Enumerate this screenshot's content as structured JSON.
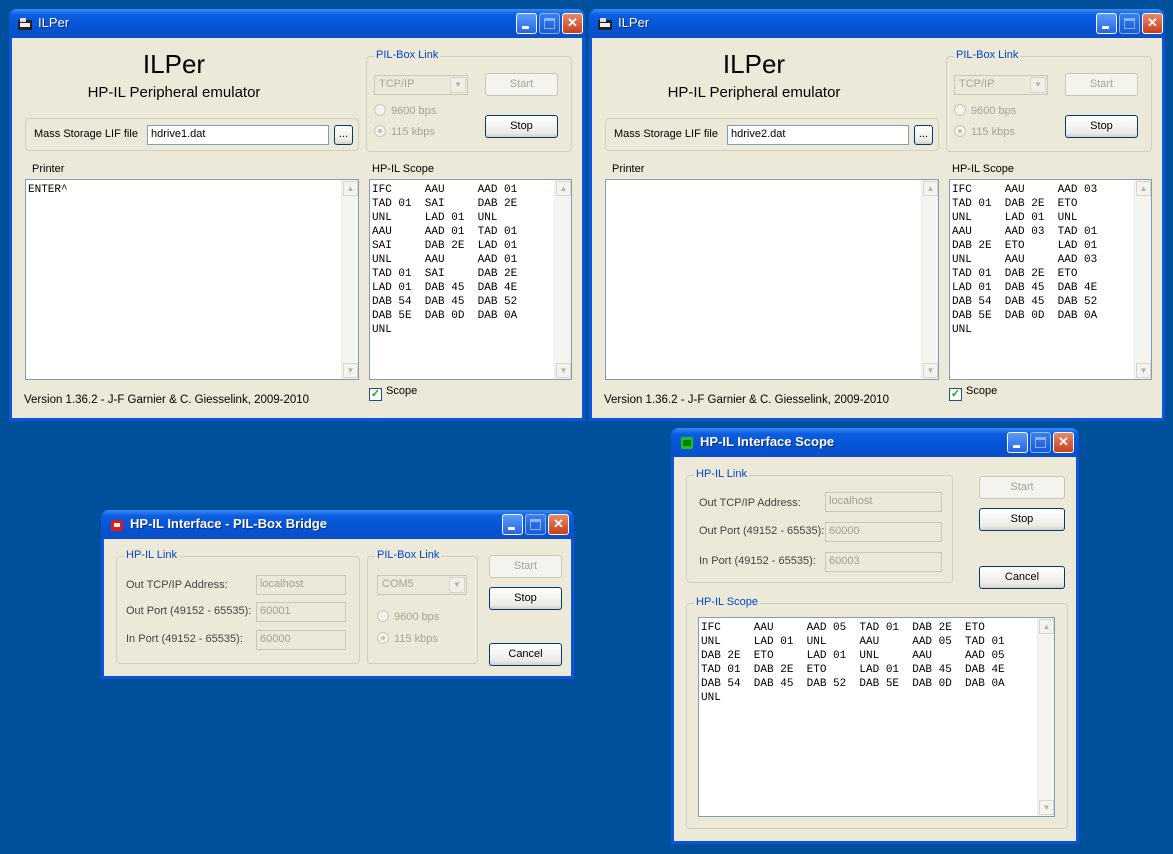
{
  "ilper1": {
    "window_title": "ILPer",
    "app_name": "ILPer",
    "app_subtitle": "HP-IL Peripheral emulator",
    "pilbox_group": "PIL-Box Link",
    "port_value": "TCP/IP",
    "baud_9600": "9600 bps",
    "baud_115": "115 kbps",
    "start_label": "Start",
    "stop_label": "Stop",
    "mass_storage_label": "Mass Storage LIF file",
    "mass_storage_value": "hdrive1.dat",
    "browse_label": "...",
    "printer_label": "Printer",
    "printer_text": "ENTER^",
    "scope_label": "HP-IL Scope",
    "scope_text": "IFC     AAU     AAD 01\nTAD 01  SAI     DAB 2E\nUNL     LAD 01  UNL\nAAU     AAD 01  TAD 01\nSAI     DAB 2E  LAD 01\nUNL     AAU     AAD 01\nTAD 01  SAI     DAB 2E\nLAD 01  DAB 45  DAB 4E\nDAB 54  DAB 45  DAB 52\nDAB 5E  DAB 0D  DAB 0A\nUNL",
    "scope_checkbox": "Scope",
    "version": "Version 1.36.2  -  J-F Garnier & C. Giesselink, 2009-2010"
  },
  "ilper2": {
    "window_title": "ILPer",
    "app_name": "ILPer",
    "app_subtitle": "HP-IL Peripheral emulator",
    "pilbox_group": "PIL-Box Link",
    "port_value": "TCP/IP",
    "baud_9600": "9600 bps",
    "baud_115": "115 kbps",
    "start_label": "Start",
    "stop_label": "Stop",
    "mass_storage_label": "Mass Storage LIF file",
    "mass_storage_value": "hdrive2.dat",
    "browse_label": "...",
    "printer_label": "Printer",
    "printer_text": "",
    "scope_label": "HP-IL Scope",
    "scope_text": "IFC     AAU     AAD 03\nTAD 01  DAB 2E  ETO\nUNL     LAD 01  UNL\nAAU     AAD 03  TAD 01\nDAB 2E  ETO     LAD 01\nUNL     AAU     AAD 03\nTAD 01  DAB 2E  ETO\nLAD 01  DAB 45  DAB 4E\nDAB 54  DAB 45  DAB 52\nDAB 5E  DAB 0D  DAB 0A\nUNL",
    "scope_checkbox": "Scope",
    "version": "Version 1.36.2  -  J-F Garnier & C. Giesselink, 2009-2010"
  },
  "bridge": {
    "window_title": "HP-IL Interface - PIL-Box Bridge",
    "hpil_group": "HP-IL Link",
    "out_addr_label": "Out TCP/IP Address:",
    "out_addr_value": "localhost",
    "out_port_label": "Out Port (49152 - 65535):",
    "out_port_value": "60001",
    "in_port_label": "In Port (49152 - 65535):",
    "in_port_value": "60000",
    "pilbox_group": "PIL-Box Link",
    "com_value": "COM5",
    "baud_9600": "9600 bps",
    "baud_115": "115 kbps",
    "start_label": "Start",
    "stop_label": "Stop",
    "cancel_label": "Cancel"
  },
  "scope_win": {
    "window_title": "HP-IL Interface Scope",
    "hpil_group": "HP-IL Link",
    "out_addr_label": "Out TCP/IP Address:",
    "out_addr_value": "localhost",
    "out_port_label": "Out Port (49152 - 65535):",
    "out_port_value": "60000",
    "in_port_label": "In Port (49152 - 65535):",
    "in_port_value": "60003",
    "start_label": "Start",
    "stop_label": "Stop",
    "cancel_label": "Cancel",
    "scope_label": "HP-IL Scope",
    "scope_text": "IFC     AAU     AAD 05  TAD 01  DAB 2E  ETO\nUNL     LAD 01  UNL     AAU     AAD 05  TAD 01\nDAB 2E  ETO     LAD 01  UNL     AAU     AAD 05\nTAD 01  DAB 2E  ETO     LAD 01  DAB 45  DAB 4E\nDAB 54  DAB 45  DAB 52  DAB 5E  DAB 0D  DAB 0A\nUNL"
  },
  "colors": {
    "desktop": "#004f9b",
    "titlebar": "#0653d6",
    "window_bg": "#ece9d8",
    "group_label": "#0046d5"
  }
}
